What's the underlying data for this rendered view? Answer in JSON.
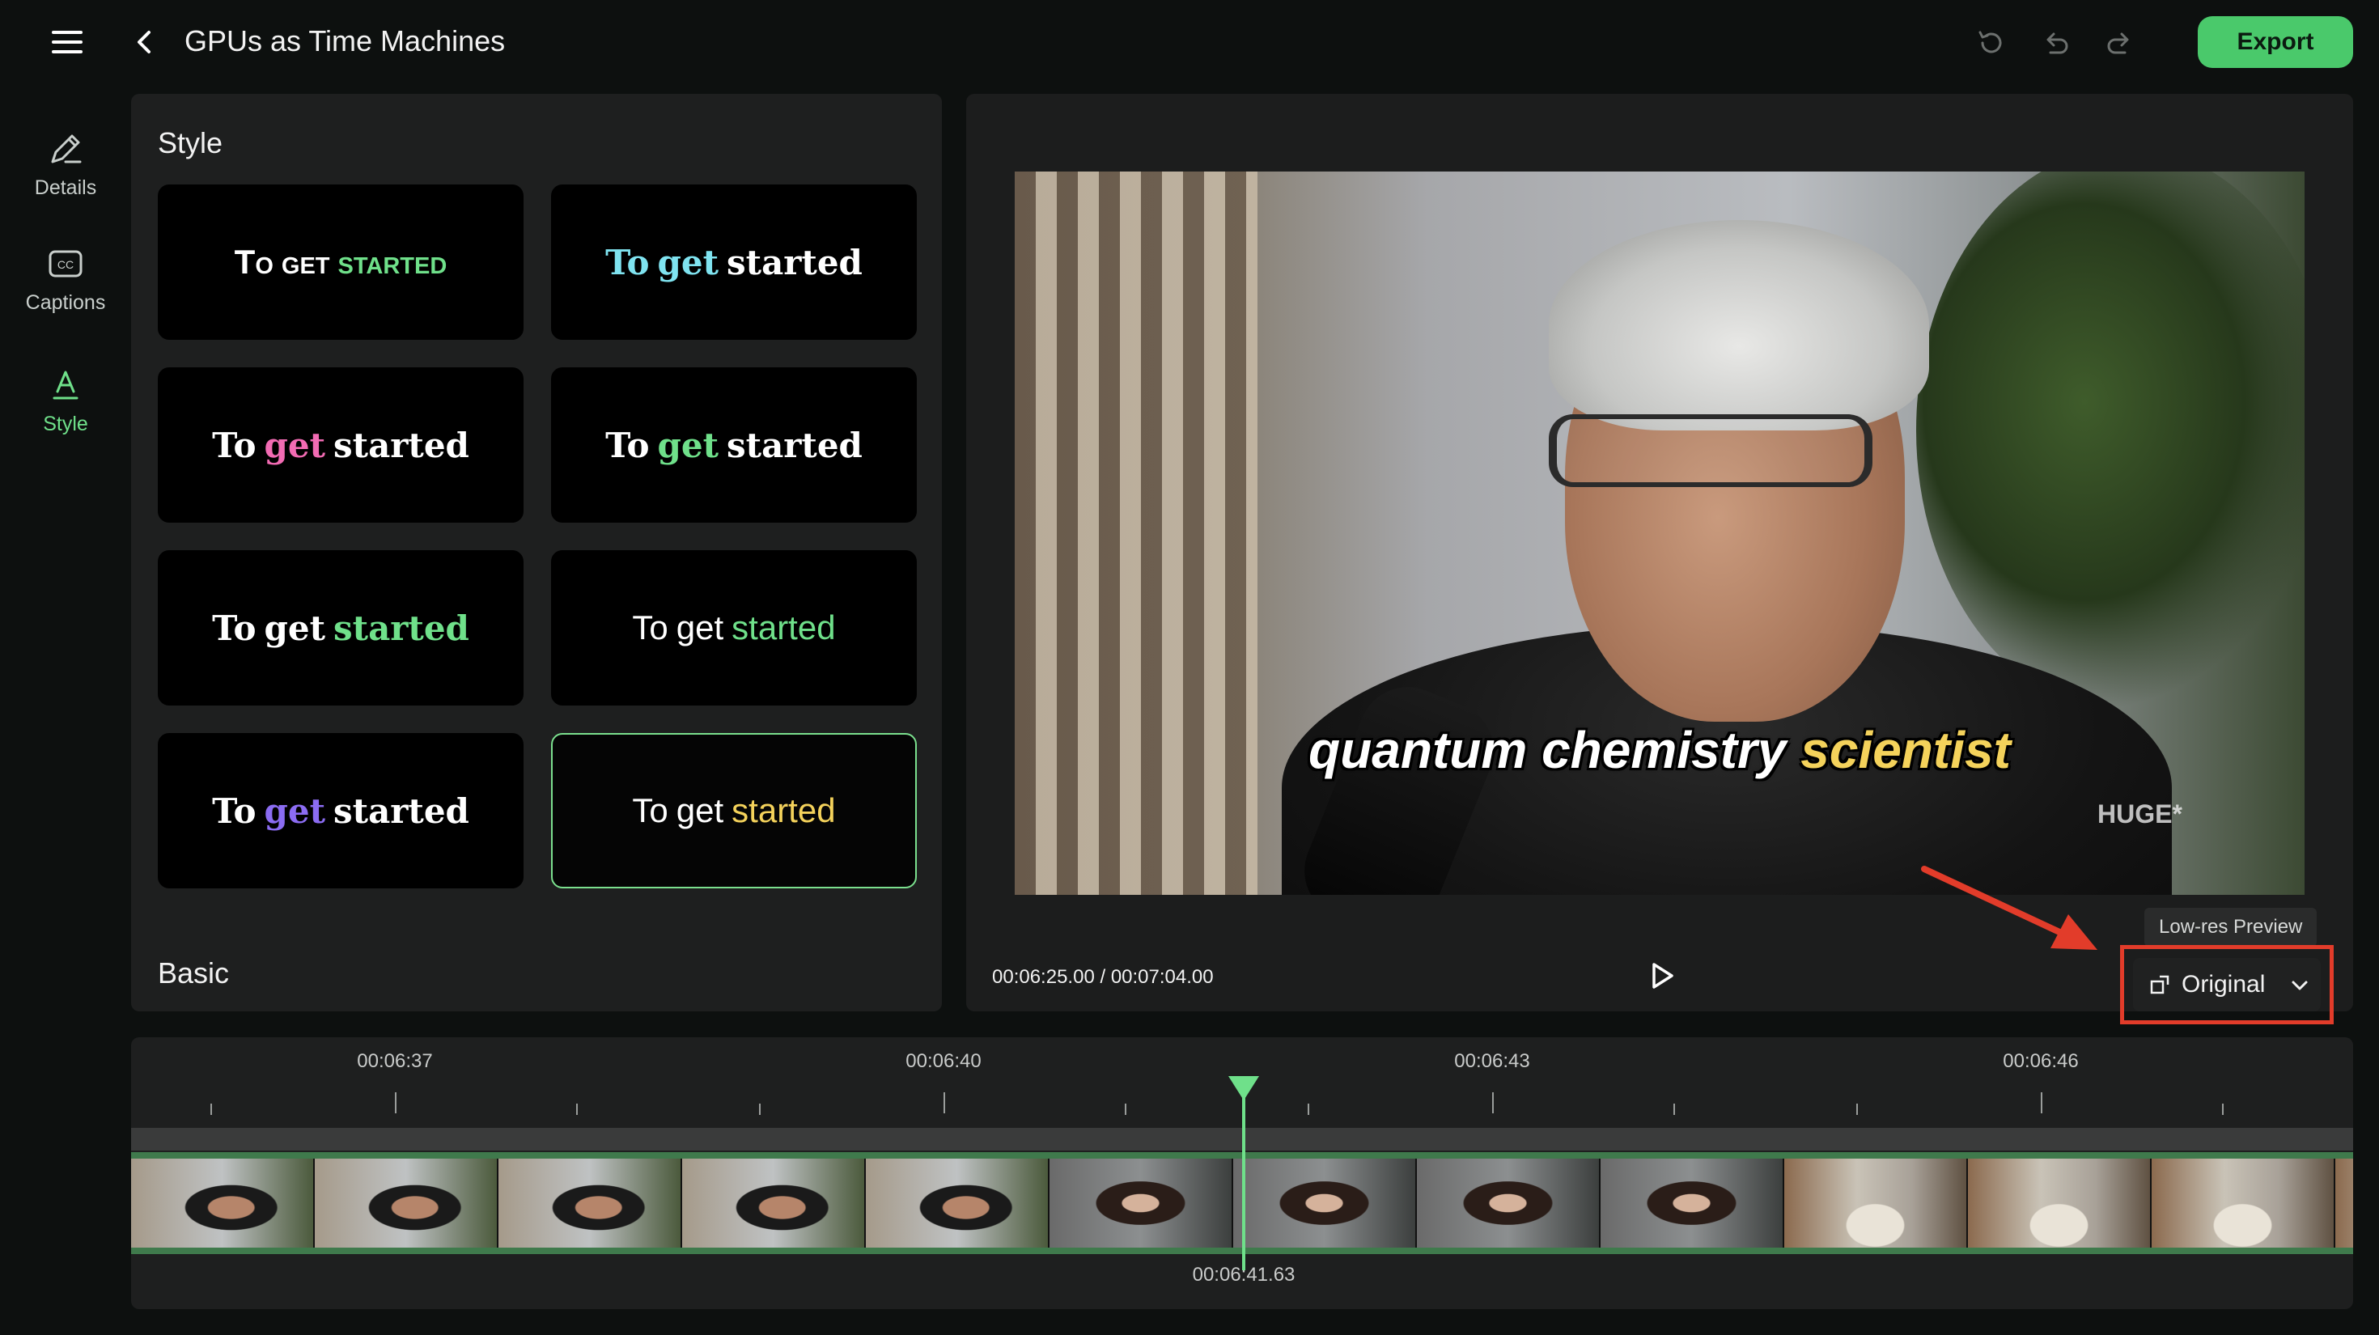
{
  "header": {
    "title": "GPUs as Time Machines",
    "export_label": "Export"
  },
  "rail": [
    {
      "label": "Details",
      "icon": "pencil-ruler-icon",
      "active": false
    },
    {
      "label": "Captions",
      "icon": "cc-icon",
      "active": false
    },
    {
      "label": "Style",
      "icon": "text-style-icon",
      "active": true
    }
  ],
  "style_panel": {
    "heading": "Style",
    "basic_heading": "Basic",
    "presets": [
      {
        "w1": "To",
        "w2": "get",
        "w3": "started",
        "c1": "#ffffff",
        "c2": "#ffffff",
        "c3": "#6fe08a",
        "font": "sans-serif",
        "weight": "bold",
        "variant": "small-caps",
        "selected": false
      },
      {
        "w1": "To",
        "w2": "get",
        "w3": "started",
        "c1": "#7fe3f0",
        "c2": "#7fe3f0",
        "c3": "#ffffff",
        "font": "serif",
        "weight": "bold",
        "variant": "normal",
        "selected": false
      },
      {
        "w1": "To",
        "w2": "get",
        "w3": "started",
        "c1": "#ffffff",
        "c2": "#f26bb3",
        "c3": "#ffffff",
        "font": "serif",
        "weight": "bold",
        "variant": "normal",
        "selected": false
      },
      {
        "w1": "To",
        "w2": "get",
        "w3": "started",
        "c1": "#ffffff",
        "c2": "#6fe08a",
        "c3": "#ffffff",
        "font": "serif",
        "weight": "bold",
        "variant": "normal",
        "selected": false
      },
      {
        "w1": "To",
        "w2": "get",
        "w3": "started",
        "c1": "#ffffff",
        "c2": "#ffffff",
        "c3": "#6fe08a",
        "font": "serif",
        "weight": "bold",
        "variant": "normal",
        "selected": false
      },
      {
        "w1": "To",
        "w2": "get",
        "w3": "started",
        "c1": "#ffffff",
        "c2": "#ffffff",
        "c3": "#6fe08a",
        "font": "sans-serif",
        "weight": "normal",
        "variant": "normal",
        "selected": false
      },
      {
        "w1": "To",
        "w2": "get",
        "w3": "started",
        "c1": "#ffffff",
        "c2": "#8b6cf2",
        "c3": "#ffffff",
        "font": "serif",
        "weight": "bold",
        "variant": "normal",
        "selected": false
      },
      {
        "w1": "To",
        "w2": "get",
        "w3": "started",
        "c1": "#ffffff",
        "c2": "#ffffff",
        "c3": "#f4d25b",
        "font": "sans-serif",
        "weight": "normal",
        "variant": "normal",
        "selected": true
      }
    ]
  },
  "preview": {
    "caption_plain": "quantum chemistry",
    "caption_accent": "scientist",
    "watermark": "HUGE*",
    "current_time": "00:06:25.00",
    "duration": "00:07:04.00",
    "tooltip": "Low-res Preview",
    "quality_label": "Original",
    "accent_color": "#6fe08a",
    "annotation_color": "#e23c2a"
  },
  "timeline": {
    "tick_labels": [
      "00:06:37",
      "00:06:40",
      "00:06:43",
      "00:06:46"
    ],
    "playhead_time": "00:06:41.63"
  }
}
